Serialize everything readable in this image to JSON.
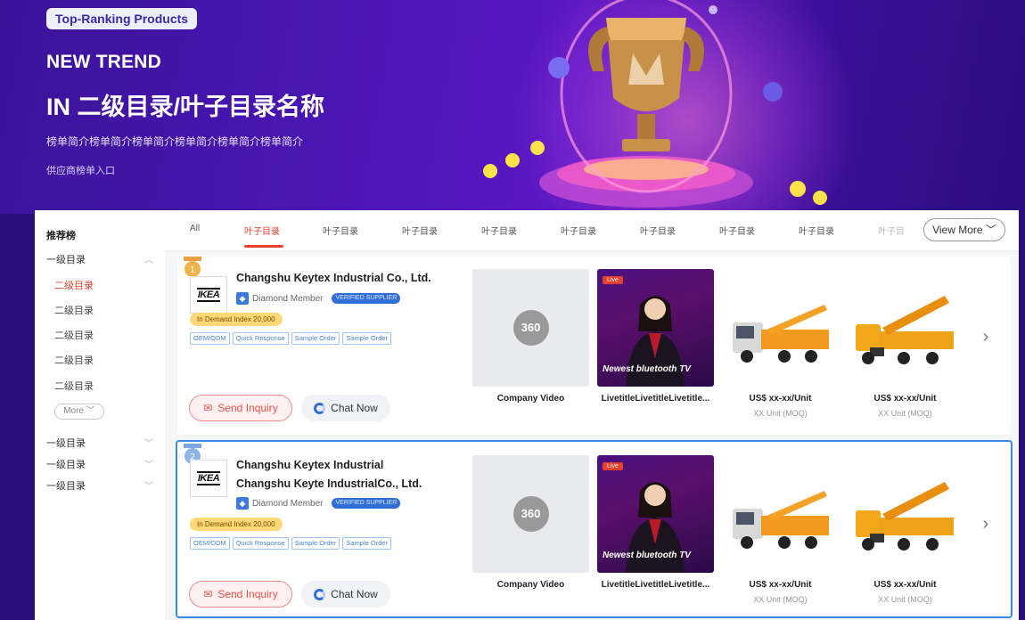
{
  "hero": {
    "badge": "Top-Ranking Products",
    "line1": "NEW TREND",
    "line2": "IN 二级目录/叶子目录名称",
    "desc": "榜单简介榜单简介榜单简介榜单简介榜单简介榜单简介",
    "link": "供应商榜单入口"
  },
  "sidebar": {
    "heading": "推荐榜",
    "group1": "一级目录",
    "subs": [
      "二级目录",
      "二级目录",
      "二级目录",
      "二级目录",
      "二级目录"
    ],
    "more": "More",
    "groups": [
      "一级目录",
      "一级目录",
      "一级目录"
    ]
  },
  "tabs": {
    "items": [
      "All",
      "叶子目录",
      "叶子目录",
      "叶子目录",
      "叶子目录",
      "叶子目录",
      "叶子目录",
      "叶子目录",
      "叶子目录",
      "叶子目"
    ],
    "active_index": 1,
    "view_more": "View More"
  },
  "cards": [
    {
      "name_lines": [
        "Changshu Keytex Industrial Co., Ltd."
      ],
      "logo": "IKEA",
      "member": "Diamond Member",
      "verified": "VERIFIED SUPPLIER",
      "demand": "In Demand Index 20,000",
      "tags": [
        "OEM/ODM",
        "Quick Response",
        "Sample Order",
        "Sample Order"
      ],
      "inquiry": "Send Inquiry",
      "chat": "Chat Now",
      "video_label": "360",
      "video_title": "Company Video",
      "live_tag": "Live",
      "live_caption": "Newest bluetooth TV",
      "live_title": "LivetitleLivetitleLivetitle...",
      "product1_price": "US$ xx-xx/Unit",
      "product1_moq": "XX Unit (MOQ)",
      "product2_price": "US$ xx-xx/Unit",
      "product2_moq": "XX Unit (MOQ)"
    },
    {
      "name_lines": [
        "Changshu Keytex Industrial",
        "Changshu Keyte IndustrialCo., Ltd."
      ],
      "logo": "IKEA",
      "member": "Diamond Member",
      "verified": "VERIFIED SUPPLIER",
      "demand": "In Demand Index 20,000",
      "tags": [
        "OEM/ODM",
        "Quick Response",
        "Sample Order",
        "Sample Order"
      ],
      "inquiry": "Send Inquiry",
      "chat": "Chat Now",
      "video_label": "360",
      "video_title": "Company Video",
      "live_tag": "Live",
      "live_caption": "Newest bluetooth TV",
      "live_title": "LivetitleLivetitleLivetitle...",
      "product1_price": "US$ xx-xx/Unit",
      "product1_moq": "XX Unit (MOQ)",
      "product2_price": "US$ xx-xx/Unit",
      "product2_moq": "XX Unit (MOQ)"
    }
  ],
  "colors": {
    "accent": "#e8402b",
    "selected_border": "#3b8ae6",
    "hero": "#4b16b4"
  }
}
